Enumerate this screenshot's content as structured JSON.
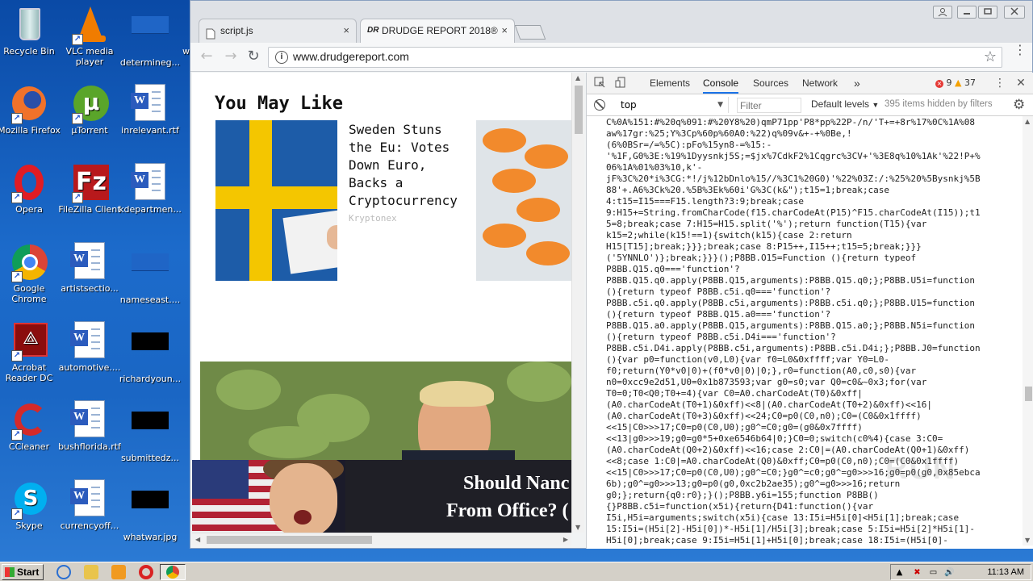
{
  "desktop": {
    "icons": [
      {
        "label": "Recycle Bin"
      },
      {
        "label": "VLC media player"
      },
      {
        "label": "determineg..."
      },
      {
        "label": "w"
      },
      {
        "label": "Mozilla Firefox"
      },
      {
        "label": "µTorrent"
      },
      {
        "label": "inrelevant.rtf"
      },
      {
        "label": "Opera"
      },
      {
        "label": "FileZilla Client"
      },
      {
        "label": "kdepartmen..."
      },
      {
        "label": "Google Chrome"
      },
      {
        "label": "artistsectio..."
      },
      {
        "label": "nameseast...."
      },
      {
        "label": "Acrobat Reader DC"
      },
      {
        "label": "automotive...."
      },
      {
        "label": "richardyoun..."
      },
      {
        "label": "CCleaner"
      },
      {
        "label": "bushflorida.rtf"
      },
      {
        "label": "submittedz..."
      },
      {
        "label": "Skype"
      },
      {
        "label": "currencyoff..."
      },
      {
        "label": "whatwar.jpg"
      }
    ]
  },
  "browser": {
    "tabs": [
      {
        "title": "script.js",
        "close": "×"
      },
      {
        "title": "DRUDGE REPORT 2018®",
        "close": "×"
      }
    ],
    "url": "www.drudgereport.com",
    "nav": {
      "back": "←",
      "forward": "→",
      "reload": "↻",
      "star": "☆",
      "menu": "⋮",
      "info": "i"
    }
  },
  "page": {
    "section_title": "You May Like",
    "story1": {
      "headline": "Sweden Stuns the Eu: Votes Down Euro, Backs a Cryptocurrency",
      "source": "Kryptonex"
    },
    "story3": {
      "overlay_line1": "Should Nanc",
      "overlay_line2": "From Office? ("
    }
  },
  "devtools": {
    "tabs": [
      "Elements",
      "Console",
      "Sources",
      "Network"
    ],
    "more": "»",
    "errors": "9",
    "warnings": "37",
    "context": "top",
    "filter_placeholder": "Filter",
    "levels": "Default levels",
    "hidden": "395 items hidden by filters",
    "console_lines": [
      "C%0A%151:#%20q%091:#%20Y8%20)qmP71pp'P8*pp%22P-/n/'T+=+8r%17%0C%1A%08",
      "aw%17gr:%25;Y%3Cp%60p%60A0:%22)q%09v&+-+%0Be,!",
      "(6%0BSr=/=%5C):pFo%15yn8-=%15:-",
      "'%1F,G0%3E:%19%1Dyysnkj5S;=$jx%7CdkF2%1Cqgrc%3CV+'%3E8q%10%1Ak'%22!P+%",
      "06%1A%01%03%10,k'-",
      "jF%3C%20*i%3CG:*!/j%12bDnlo%15//%3C1%20G0)'%22%03Z:/:%25%20%5Bysnkj%5B",
      "88'+.A6%3Ck%20.%5B%3Ek%60i'G%3C(k&\");t15=1;break;case",
      "4:t15=I15===F15.length?3:9;break;case",
      "9:H15+=String.fromCharCode(f15.charCodeAt(P15)^F15.charCodeAt(I15));t1",
      "5=8;break;case 7:H15=H15.split('%');return function(T15){var",
      "k15=2;while(k15!==1){switch(k15){case 2:return",
      "H15[T15];break;}}};break;case 8:P15++,I15++;t15=5;break;}}}",
      "('5YNNLO')};break;}}}();P8BB.O15=Function (){return typeof",
      "P8BB.Q15.q0==='function'?",
      "P8BB.Q15.q0.apply(P8BB.Q15,arguments):P8BB.Q15.q0;};P8BB.U5i=function",
      "(){return typeof P8BB.c5i.q0==='function'?",
      "P8BB.c5i.q0.apply(P8BB.c5i,arguments):P8BB.c5i.q0;};P8BB.U15=function",
      "(){return typeof P8BB.Q15.a0==='function'?",
      "P8BB.Q15.a0.apply(P8BB.Q15,arguments):P8BB.Q15.a0;};P8BB.N5i=function",
      "(){return typeof P8BB.c5i.D4i==='function'?",
      "P8BB.c5i.D4i.apply(P8BB.c5i,arguments):P8BB.c5i.D4i;};P8BB.J0=function",
      "(){var p0=function(v0,L0){var f0=L0&0xffff;var Y0=L0-",
      "f0;return(Y0*v0|0)+(f0*v0|0)|0;},r0=function(A0,c0,s0){var",
      "n0=0xcc9e2d51,U0=0x1b873593;var g0=s0;var Q0=c0&~0x3;for(var",
      "T0=0;T0<Q0;T0+=4){var C0=A0.charCodeAt(T0)&0xff|",
      "(A0.charCodeAt(T0+1)&0xff)<<8|(A0.charCodeAt(T0+2)&0xff)<<16|",
      "(A0.charCodeAt(T0+3)&0xff)<<24;C0=p0(C0,n0);C0=(C0&0x1ffff)",
      "<<15|C0>>>17;C0=p0(C0,U0);g0^=C0;g0=(g0&0x7ffff)",
      "<<13|g0>>>19;g0=g0*5+0xe6546b64|0;}C0=0;switch(c0%4){case 3:C0=",
      "(A0.charCodeAt(Q0+2)&0xff)<<16;case 2:C0|=(A0.charCodeAt(Q0+1)&0xff)",
      "<<8;case 1:C0|=A0.charCodeAt(Q0)&0xff;C0=p0(C0,n0);C0=(C0&0x1ffff)",
      "<<15|C0>>>17;C0=p0(C0,U0);g0^=C0;}g0^=c0;g0^=g0>>>16;g0=p0(g0,0x85ebca",
      "6b);g0^=g0>>>13;g0=p0(g0,0xc2b2ae35);g0^=g0>>>16;return",
      "g0;};return{q0:r0};}();P8BB.y6i=155;function P8BB()",
      "{}P8BB.c5i=function(x5i){return{D41:function(){var",
      "I5i,H5i=arguments;switch(x5i){case 13:I5i=H5i[0]<H5i[1];break;case",
      "15:I5i=(H5i[2]-H5i[0])*-H5i[1]/H5i[3];break;case 5:I5i=H5i[2]*H5i[1]-",
      "H5i[0];break;case 9:I5i=H5i[1]+H5i[0];break;case 18:I5i=(H5i[0]-"
    ],
    "watermark": "RUN"
  },
  "taskbar": {
    "start": "Start",
    "time": "11:13 AM"
  }
}
